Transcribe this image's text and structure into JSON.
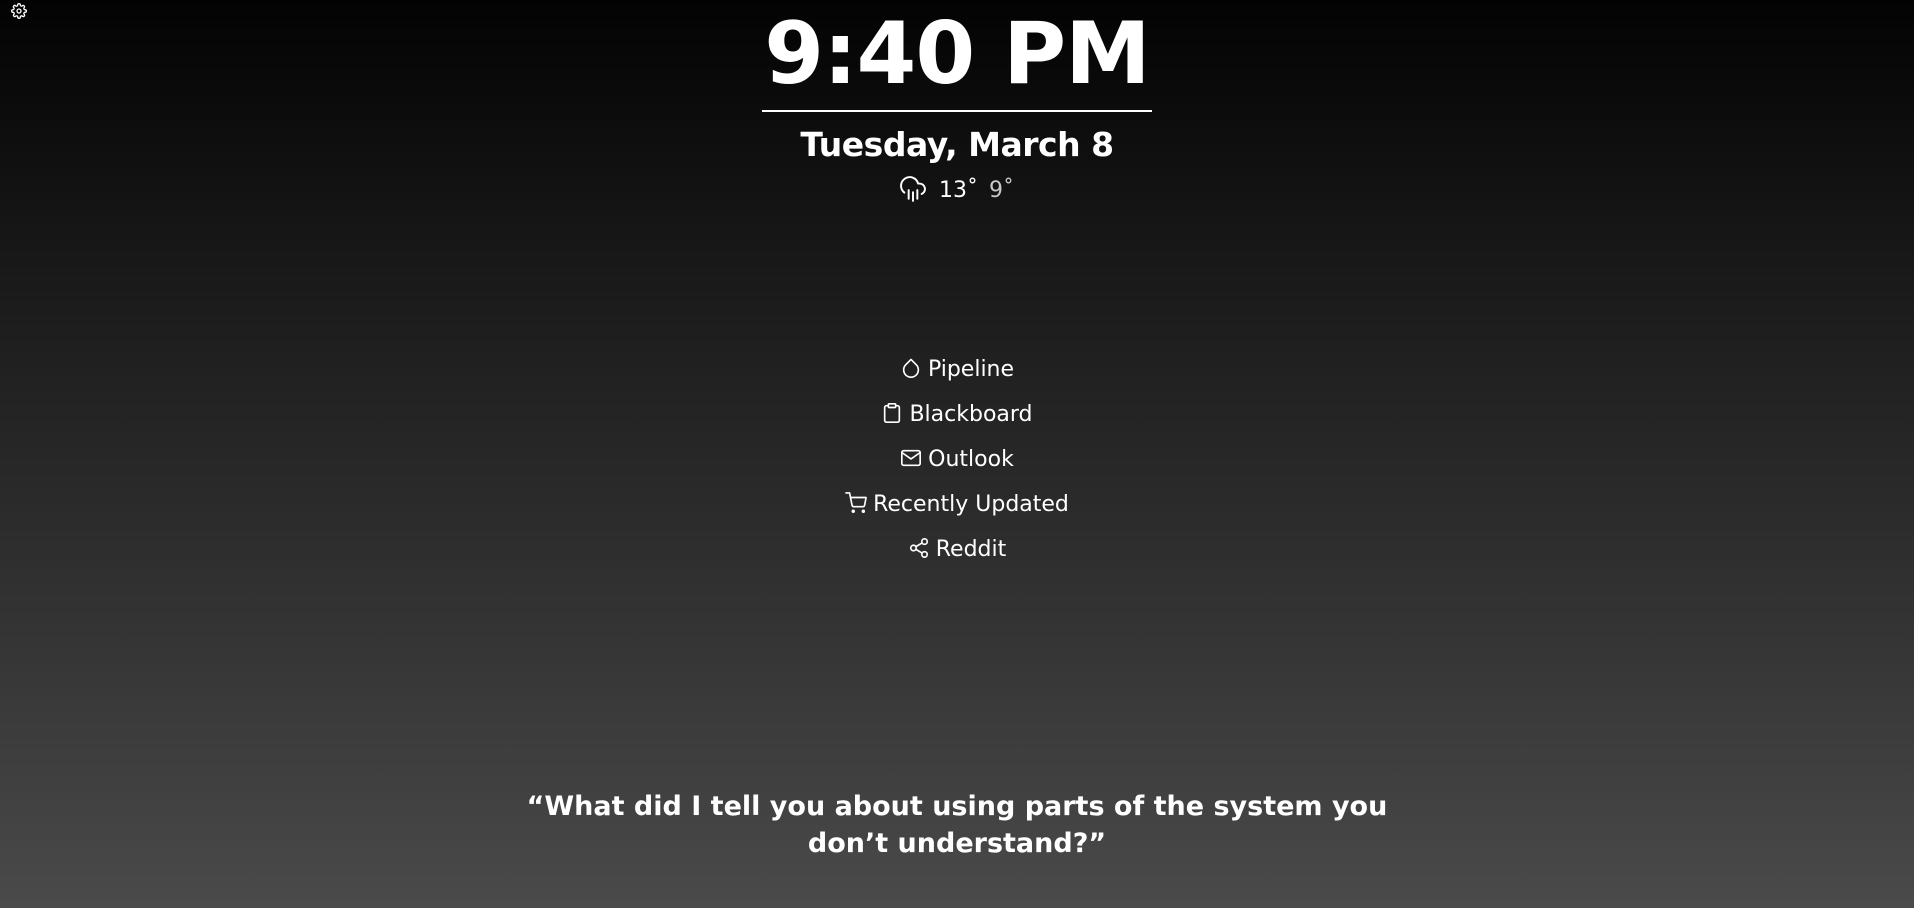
{
  "settings": {
    "icon": "gear-icon"
  },
  "clock": {
    "time": "9:40 PM",
    "date": "Tuesday, March 8"
  },
  "weather": {
    "icon": "cloud-rain-icon",
    "high": "13˚",
    "low": "9˚"
  },
  "links": [
    {
      "label": "Pipeline",
      "icon": "droplet-icon"
    },
    {
      "label": "Blackboard",
      "icon": "clipboard-icon"
    },
    {
      "label": "Outlook",
      "icon": "mail-icon"
    },
    {
      "label": "Recently Updated",
      "icon": "shopping-cart-icon"
    },
    {
      "label": "Reddit",
      "icon": "share-icon"
    }
  ],
  "quote": {
    "text": "“What did I tell you about using parts of the system you don’t understand?”"
  }
}
